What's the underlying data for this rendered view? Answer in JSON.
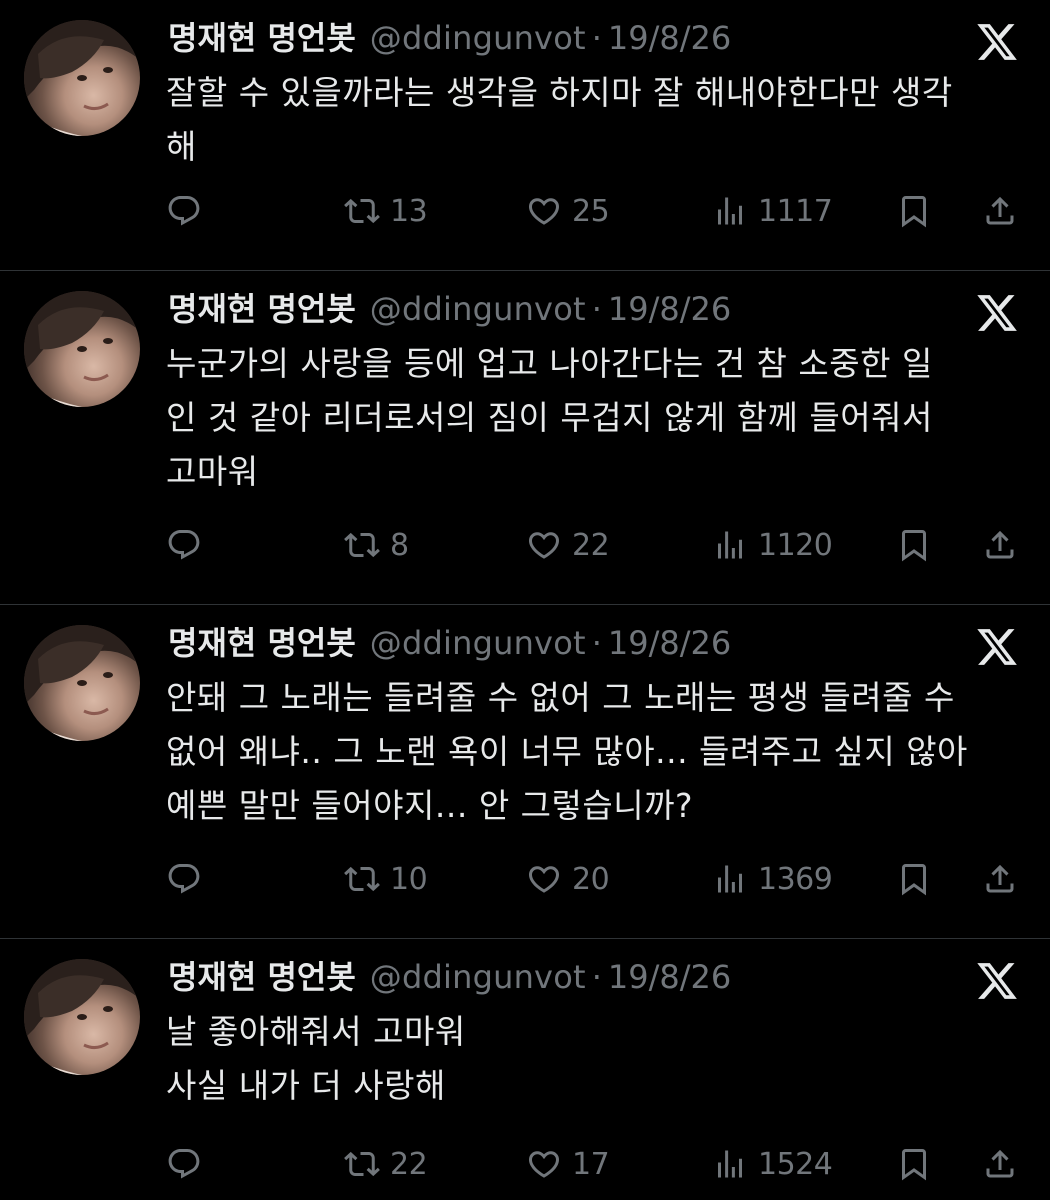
{
  "tweets": [
    {
      "name": "명재현 명언봇",
      "handle": "@ddingunvot",
      "dot": "·",
      "date": "19/8/26",
      "lines": [
        "잘할 수 있을까라는 생각을 하지마 잘 해내야한다만 생각",
        "해"
      ],
      "retweets": "13",
      "likes": "25",
      "views": "1117"
    },
    {
      "name": "명재현 명언봇",
      "handle": "@ddingunvot",
      "dot": "·",
      "date": "19/8/26",
      "lines": [
        "누군가의 사랑을 등에 업고 나아간다는 건 참 소중한 일",
        "인 것 같아 리더로서의 짐이 무겁지 않게 함께 들어줘서",
        "고마워"
      ],
      "retweets": "8",
      "likes": "22",
      "views": "1120"
    },
    {
      "name": "명재현 명언봇",
      "handle": "@ddingunvot",
      "dot": "·",
      "date": "19/8/26",
      "lines": [
        "안돼 그 노래는 들려줄 수 없어 그 노래는 평생 들려줄 수",
        "없어 왜냐.. 그 노랜 욕이 너무 많아... 들려주고 싶지 않아",
        "예쁜 말만 들어야지... 안 그렇습니까?"
      ],
      "retweets": "10",
      "likes": "20",
      "views": "1369"
    },
    {
      "name": "명재현 명언봇",
      "handle": "@ddingunvot",
      "dot": "·",
      "date": "19/8/26",
      "lines": [
        "날 좋아해줘서 고마워",
        "사실 내가 더 사랑해"
      ],
      "retweets": "22",
      "likes": "17",
      "views": "1524"
    }
  ],
  "icons": {
    "reply": "reply-icon",
    "retweet": "retweet-icon",
    "like": "heart-icon",
    "views": "views-icon",
    "bookmark": "bookmark-icon",
    "share": "share-icon",
    "brand": "x-logo-icon"
  },
  "colors": {
    "background": "#000000",
    "text": "#e7e9ea",
    "secondary": "#71767b",
    "divider": "#2f3336"
  }
}
